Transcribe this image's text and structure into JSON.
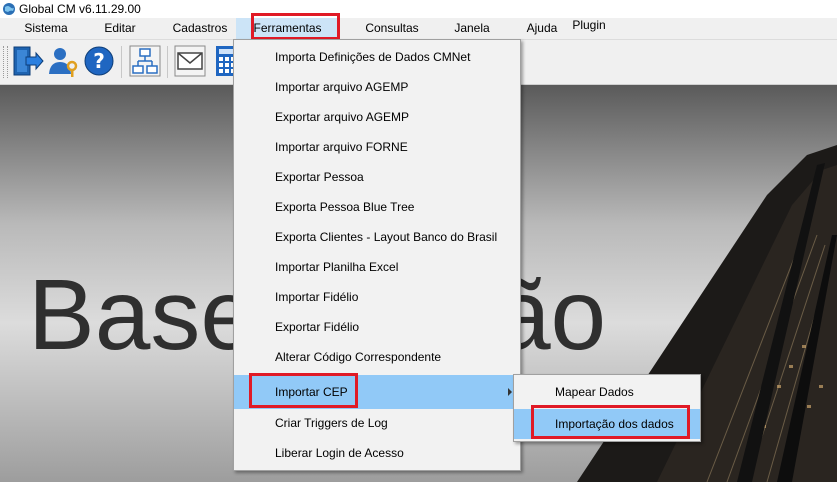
{
  "window": {
    "title": "Global CM v6.11.29.00"
  },
  "menubar": {
    "items": [
      {
        "label": "Sistema"
      },
      {
        "label": "Editar"
      },
      {
        "label": "Cadastros"
      },
      {
        "label": "Ferramentas"
      },
      {
        "label": "Consultas"
      },
      {
        "label": "Janela"
      },
      {
        "label": "Ajuda"
      },
      {
        "label": "Plugin"
      }
    ]
  },
  "toolbar": {
    "buttons": [
      {
        "icon": "exit-door-icon"
      },
      {
        "icon": "user-key-icon"
      },
      {
        "icon": "help-icon"
      },
      {
        "icon": "org-chart-icon"
      },
      {
        "icon": "mail-icon"
      },
      {
        "icon": "calculator-icon"
      }
    ]
  },
  "background": {
    "text": "Base   Padrão"
  },
  "dropdown": {
    "items": [
      {
        "label": "Importa Definições de Dados CMNet"
      },
      {
        "label": "Importar arquivo AGEMP"
      },
      {
        "label": "Exportar arquivo AGEMP"
      },
      {
        "label": "Importar arquivo FORNE"
      },
      {
        "label": "Exportar Pessoa"
      },
      {
        "label": "Exporta Pessoa Blue Tree"
      },
      {
        "label": "Exporta Clientes - Layout Banco do Brasil"
      },
      {
        "label": "Importar Planilha Excel"
      },
      {
        "label": "Importar Fidélio"
      },
      {
        "label": "Exportar Fidélio"
      },
      {
        "label": "Alterar Código Correspondente"
      },
      {
        "label": "Importar CEP"
      },
      {
        "label": "Criar Triggers de Log"
      },
      {
        "label": "Liberar Login de Acesso"
      }
    ]
  },
  "submenu": {
    "items": [
      {
        "label": "Mapear Dados"
      },
      {
        "label": "Importação dos dados"
      }
    ]
  },
  "colors": {
    "highlight": "#91c9f7",
    "annotation_red": "#e01a26",
    "menu_active": "#cce4f7"
  }
}
